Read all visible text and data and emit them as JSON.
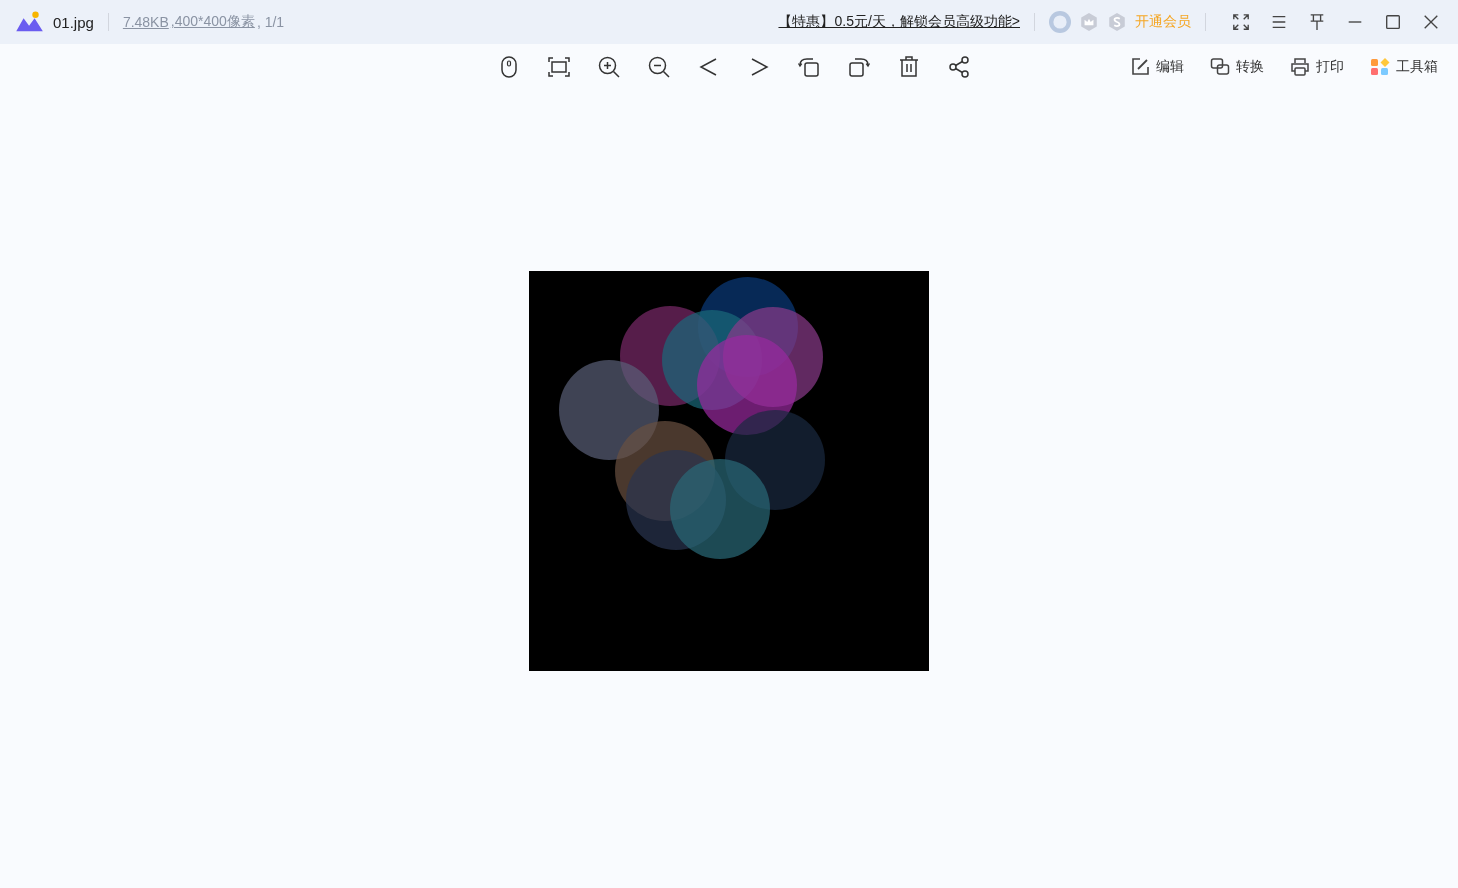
{
  "title_bar": {
    "filename": "01.jpg",
    "file_size": "7.48KB",
    "dimensions": ",400*400像素",
    "page_count": ", 1/1",
    "promo_link": "【特惠】0.5元/天，解锁会员高级功能>",
    "membership_button": "开通会员"
  },
  "tools": [
    {
      "kind": "edit",
      "label": "编辑"
    },
    {
      "kind": "convert",
      "label": "转换"
    },
    {
      "kind": "print",
      "label": "打印"
    },
    {
      "kind": "toolbox",
      "label": "工具箱"
    }
  ]
}
